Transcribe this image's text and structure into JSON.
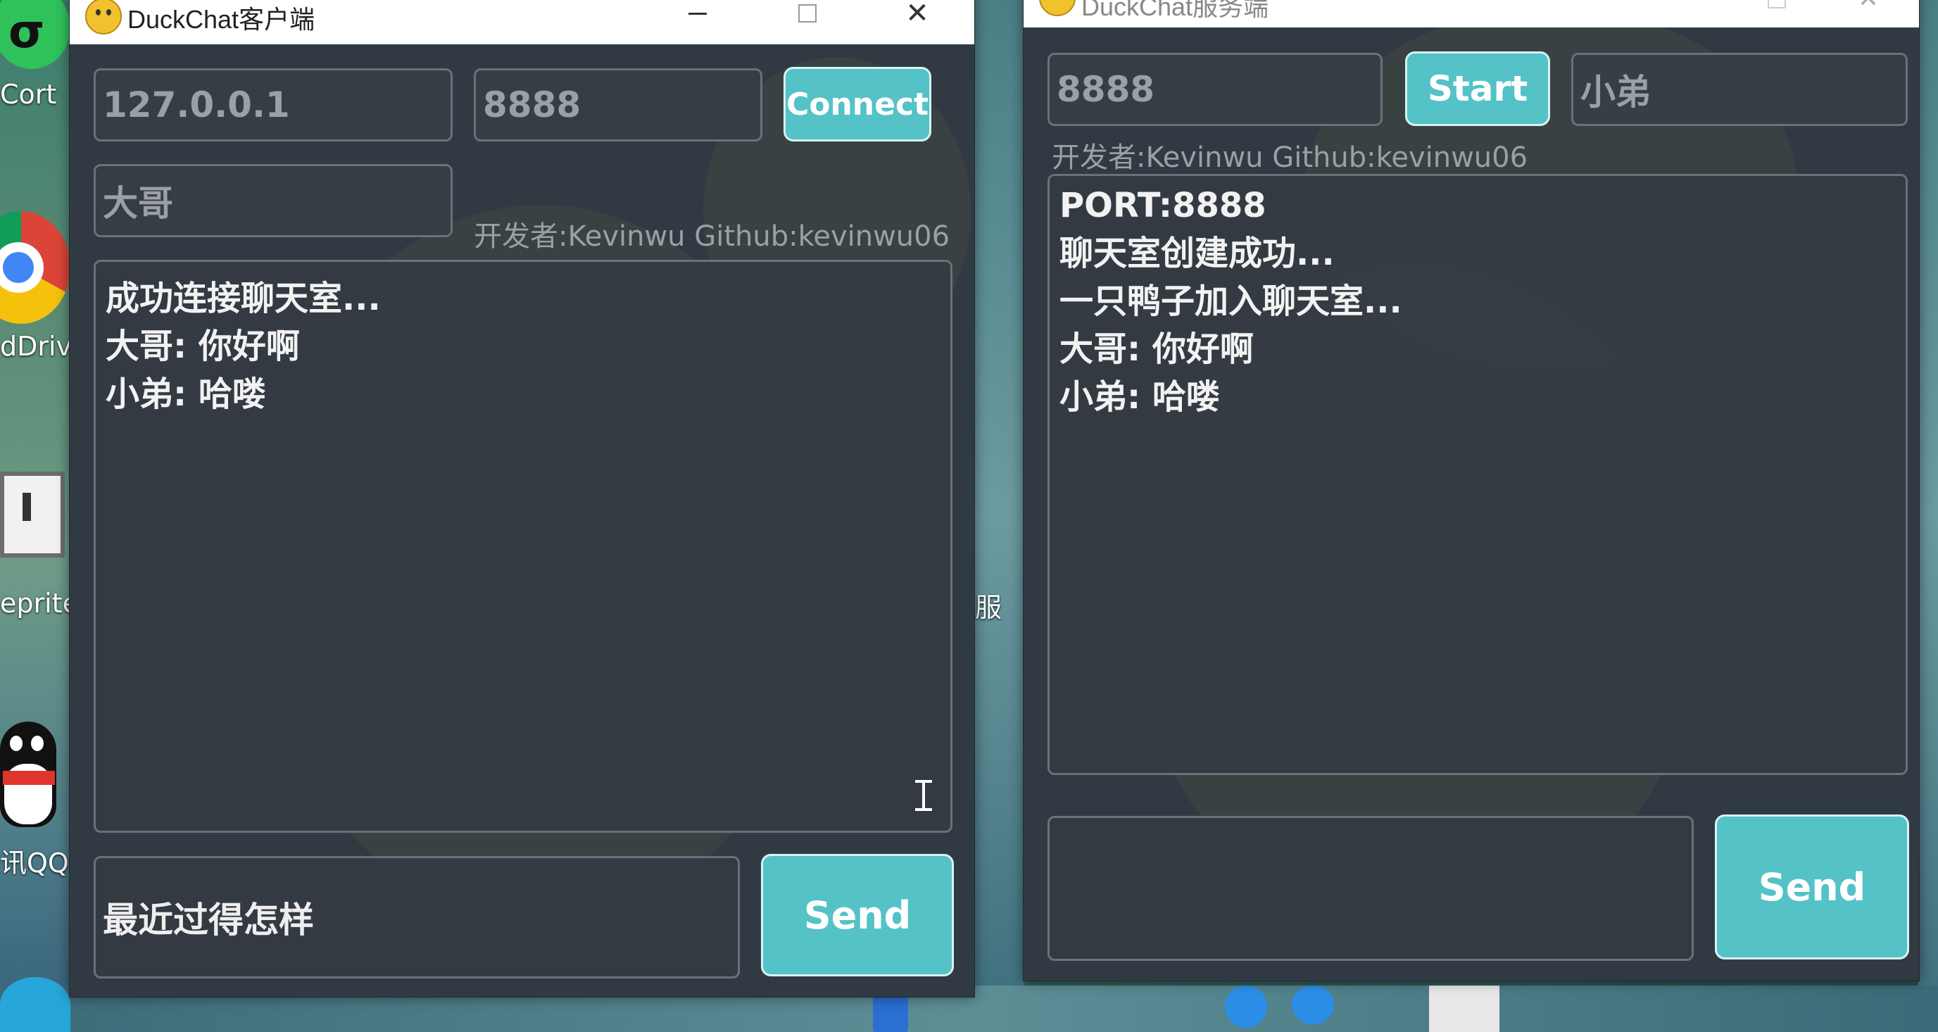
{
  "desktop": {
    "icons": [
      {
        "label": "Cort",
        "icon": "cortana-app-icon"
      },
      {
        "label": "dDrive",
        "icon": "chrome-icon"
      },
      {
        "label": "eprite",
        "icon": "aseprite-icon"
      },
      {
        "label": "讯QQ",
        "icon": "qq-penguin-icon"
      }
    ],
    "mid_label": "服"
  },
  "client": {
    "title": "DuckChat客户端",
    "ip": "127.0.0.1",
    "port": "8888",
    "connect_label": "Connect",
    "nickname": "大哥",
    "developer": "开发者:Kevinwu   Github:kevinwu06",
    "messages": [
      "成功连接聊天室...",
      "大哥: 你好啊",
      "小弟: 哈喽"
    ],
    "compose_value": "最近过得怎样",
    "send_label": "Send"
  },
  "server": {
    "title": "DuckChat服务端",
    "port": "8888",
    "start_label": "Start",
    "nickname": "小弟",
    "developer": "开发者:Kevinwu   Github:kevinwu06",
    "messages": [
      "PORT:8888",
      "聊天室创建成功...",
      "一只鸭子加入聊天室...",
      "大哥: 你好啊",
      "小弟: 哈喽"
    ],
    "compose_value": "",
    "send_label": "Send"
  },
  "colors": {
    "accent": "#54c2c7",
    "window_bg": "#313a42",
    "field_border": "#6a7178"
  }
}
